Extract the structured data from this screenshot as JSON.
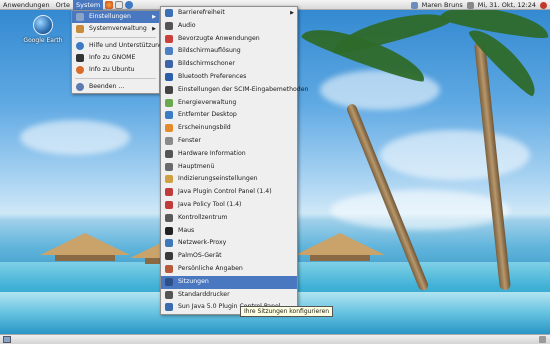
{
  "panel": {
    "menus": [
      "Anwendungen",
      "Orte",
      "System"
    ],
    "user": "Maren Bruns",
    "clock": "Mi, 31. Okt, 12:24"
  },
  "desktop_icon": {
    "label": "Google Earth",
    "icon": "google-earth-icon"
  },
  "system_menu": {
    "items": [
      {
        "label": "Einstellungen",
        "icon": "preferences-icon",
        "submenu": true,
        "selected": true
      },
      {
        "label": "Systemverwaltung",
        "icon": "administration-icon",
        "submenu": true
      },
      {
        "label": "Hilfe und Unterstützung",
        "icon": "help-icon"
      },
      {
        "label": "Info zu GNOME",
        "icon": "gnome-icon"
      },
      {
        "label": "Info zu Ubuntu",
        "icon": "ubuntu-icon"
      },
      {
        "label": "Beenden ...",
        "icon": "shutdown-icon"
      }
    ]
  },
  "einstellungen_menu": {
    "items": [
      {
        "label": "Barrierefreiheit",
        "submenu": true,
        "color": "#3b6fb6"
      },
      {
        "label": "Audio",
        "color": "#555555"
      },
      {
        "label": "Bevorzugte Anwendungen",
        "color": "#c9413a"
      },
      {
        "label": "Bildschirmauflösung",
        "color": "#4d7fc4"
      },
      {
        "label": "Bildschirmschoner",
        "color": "#3e64a8"
      },
      {
        "label": "Bluetooth Preferences",
        "color": "#2a5ea8"
      },
      {
        "label": "Einstellungen der SCIM-Eingabemethoden",
        "color": "#444444"
      },
      {
        "label": "Energieverwaltung",
        "color": "#6aa84f"
      },
      {
        "label": "Entfernter Desktop",
        "color": "#3b7dc4"
      },
      {
        "label": "Erscheinungsbild",
        "color": "#e38b2c"
      },
      {
        "label": "Fenster",
        "color": "#8a8a8a"
      },
      {
        "label": "Hardware Information",
        "color": "#555555"
      },
      {
        "label": "Hauptmenü",
        "color": "#6a6a6a"
      },
      {
        "label": "Indizierungseinstellungen",
        "color": "#d0a040"
      },
      {
        "label": "Java Plugin Control Panel (1.4)",
        "color": "#c23b3b"
      },
      {
        "label": "Java Policy Tool (1.4)",
        "color": "#c23b3b"
      },
      {
        "label": "Kontrollzentrum",
        "color": "#5a5a5a"
      },
      {
        "label": "Maus",
        "color": "#222222"
      },
      {
        "label": "Netzwerk-Proxy",
        "color": "#3f78b8"
      },
      {
        "label": "PalmOS-Gerät",
        "color": "#3a3a3a"
      },
      {
        "label": "Persönliche Angaben",
        "color": "#b85a3a"
      },
      {
        "label": "Sitzungen",
        "color": "#2d4f8a",
        "selected": true
      },
      {
        "label": "Standarddrucker",
        "color": "#555555"
      },
      {
        "label": "Sun Java 5.0 Plugin Control Panel",
        "color": "#3a6ab0"
      }
    ]
  },
  "tooltip": "Ihre Sitzungen konfigurieren",
  "colors": {
    "selection": "#4a78c0",
    "menu_bg": "#efefef"
  }
}
